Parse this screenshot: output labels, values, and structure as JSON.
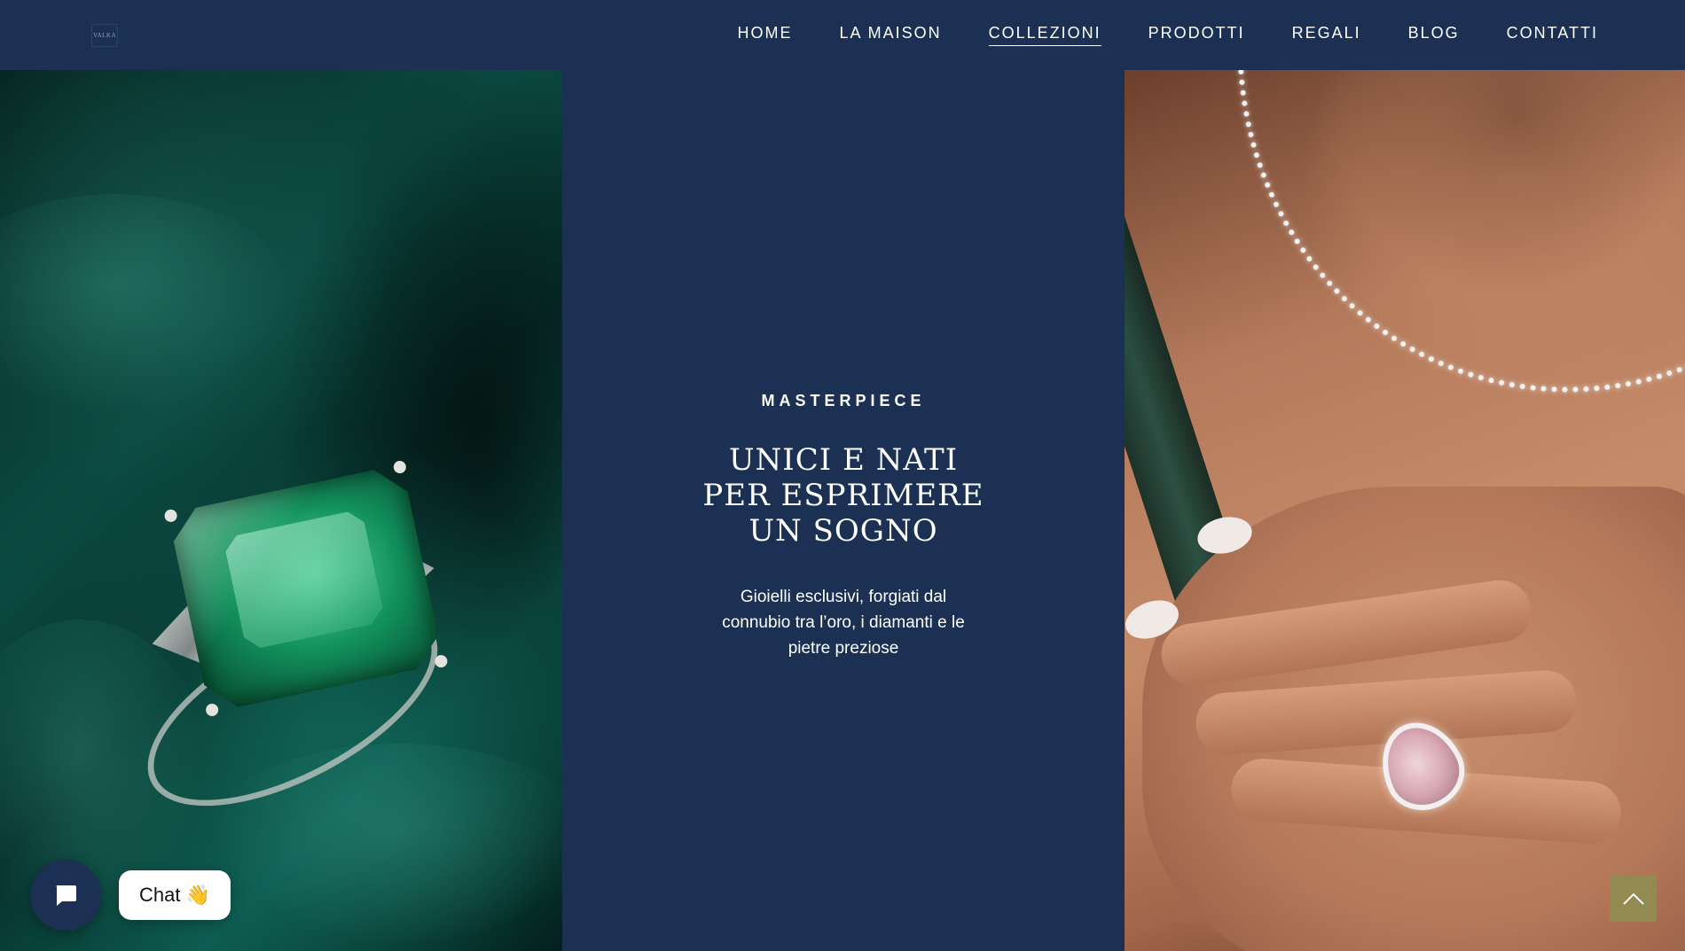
{
  "header": {
    "logo_text": "VALKA",
    "nav": [
      {
        "label": "HOME"
      },
      {
        "label": "LA MAISON"
      },
      {
        "label": "COLLEZIONI"
      },
      {
        "label": "PRODOTTI"
      },
      {
        "label": "REGALI"
      },
      {
        "label": "BLOG"
      },
      {
        "label": "CONTATTI"
      }
    ],
    "active_item": "COLLEZIONI"
  },
  "hero": {
    "eyebrow": "MASTERPIECE",
    "headline": "UNICI E NATI PER ESPRIMERE UN SOGNO",
    "subtext": "Gioielli esclusivi, forgiati dal connubio tra l’oro, i diamanti e le pietre preziose"
  },
  "images": {
    "left": "emerald-ring-on-green-satin",
    "right": "woman-wearing-diamond-necklace-and-pink-diamond-ring"
  },
  "chat": {
    "label": "Chat",
    "emoji": "👋",
    "icon": "chat-bubble-icon"
  },
  "scroll_top": {
    "icon": "chevron-up-icon"
  },
  "colors": {
    "navy": "#1b3052",
    "gold": "#938a51",
    "white": "#ffffff"
  }
}
